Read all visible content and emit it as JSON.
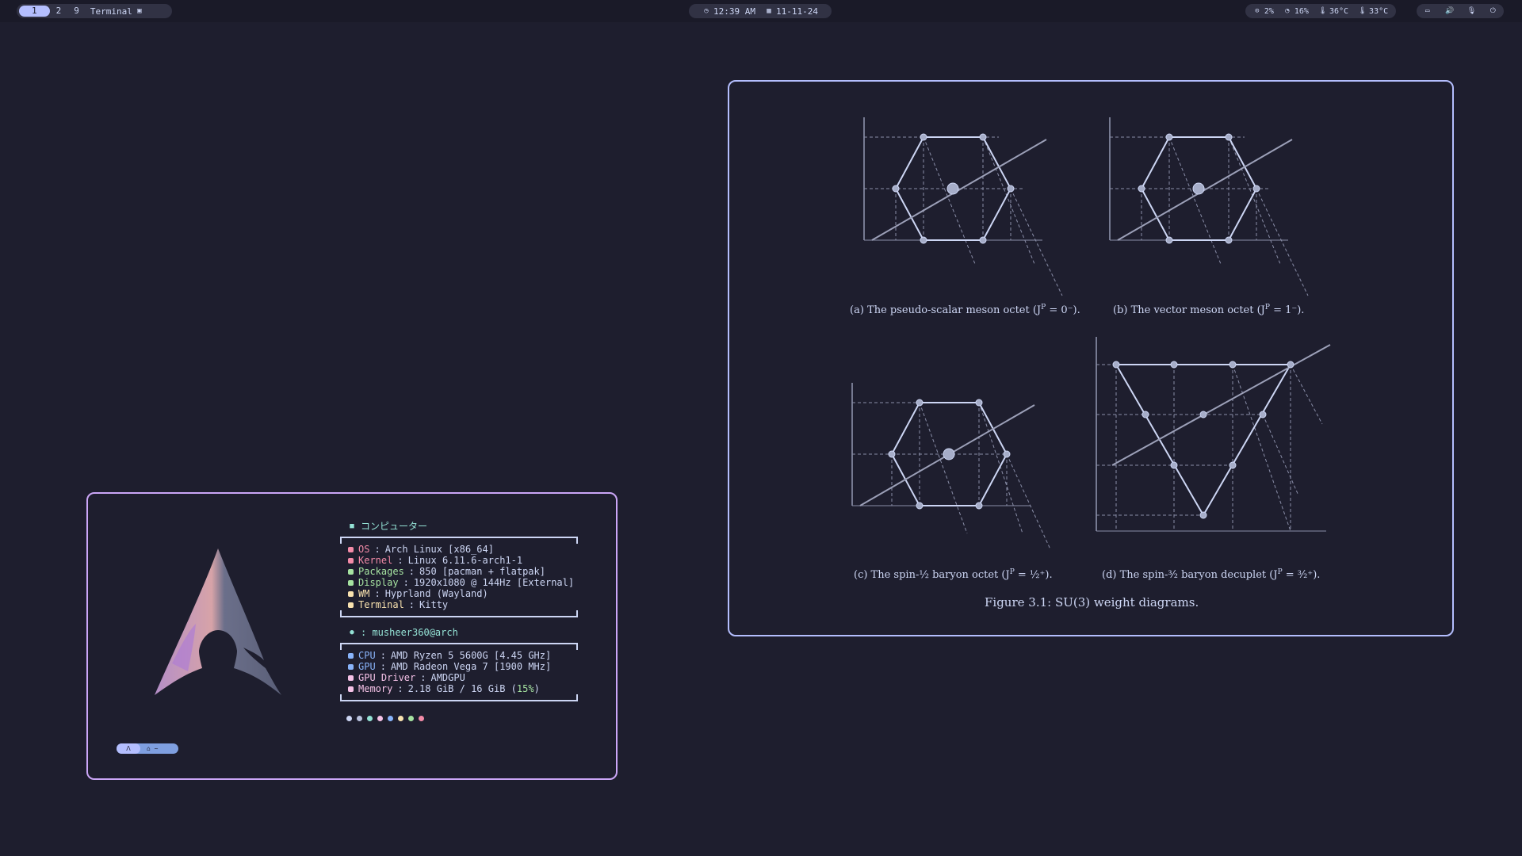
{
  "topbar": {
    "workspaces": [
      "1",
      "2",
      "9"
    ],
    "active_window": "Terminal",
    "time": "12:39 AM",
    "date": "11-11-24",
    "stats": {
      "cpu": "2%",
      "mem": "16%",
      "temp1": "36°C",
      "temp2": "33°C"
    }
  },
  "terminal": {
    "header": "コンピューター",
    "info": [
      {
        "key": "OS",
        "value": "Arch Linux [x86_64]",
        "color": "#f38ba8"
      },
      {
        "key": "Kernel",
        "value": "Linux 6.11.6-arch1-1",
        "color": "#f38ba8"
      },
      {
        "key": "Packages",
        "value": "850 [pacman + flatpak]",
        "color": "#a6e3a1"
      },
      {
        "key": "Display",
        "value": "1920x1080 @ 144Hz [External]",
        "color": "#a6e3a1"
      },
      {
        "key": "WM",
        "value": "Hyprland (Wayland)",
        "color": "#f9e2af"
      },
      {
        "key": "Terminal",
        "value": "Kitty",
        "color": "#f9e2af"
      }
    ],
    "user": ": musheer360@arch",
    "hw": [
      {
        "key": "CPU",
        "value": "AMD Ryzen 5 5600G [4.45 GHz]",
        "color": "#89b4fa"
      },
      {
        "key": "GPU",
        "value": "AMD Radeon Vega 7 [1900 MHz]",
        "color": "#89b4fa"
      },
      {
        "key": "GPU Driver",
        "value": "AMDGPU",
        "color": "#f5c2e7"
      },
      {
        "key": "Memory",
        "value": "2.18 GiB / 16 GiB (",
        "value2": "15%",
        "value3": ")",
        "color": "#f5c2e7"
      }
    ],
    "palette": [
      "#cdd6f4",
      "#bac2de",
      "#94e2d5",
      "#f5c2e7",
      "#89b4fa",
      "#f9e2af",
      "#a6e3a1",
      "#f38ba8"
    ]
  },
  "figure": {
    "caption_a": "(a) The pseudo-scalar meson octet (J",
    "caption_a_sup": "P",
    "caption_a_end": " = 0⁻).",
    "caption_b": "(b) The vector meson octet (J",
    "caption_b_end": " = 1⁻).",
    "caption_c": "(c) The spin-½ baryon octet (J",
    "caption_c_end": " = ½⁺).",
    "caption_d": "(d) The spin-³⁄₂ baryon decuplet (J",
    "caption_d_end": " = ³⁄₂⁺).",
    "title": "Figure 3.1: SU(3) weight diagrams."
  }
}
